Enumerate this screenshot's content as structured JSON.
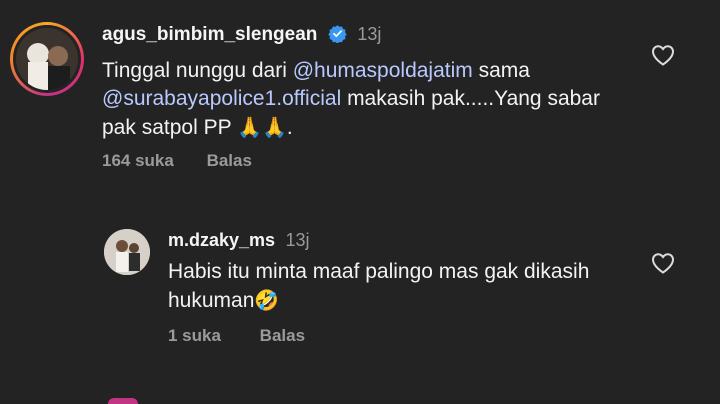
{
  "comments": [
    {
      "username": "agus_bimbim_slengean",
      "time": "13j",
      "text_before": "Tinggal nunggu dari ",
      "mention1": "@humaspoldajatim",
      "text_middle": " sama ",
      "mention2": "@surabayapolice1.official",
      "text_after": " makasih pak.....Yang sabar pak satpol PP ",
      "emoji": "🙏🙏",
      "text_end": ".",
      "likes": "164 suka",
      "reply_label": "Balas"
    },
    {
      "username": "m.dzaky_ms",
      "time": "13j",
      "text": "Habis itu minta maaf palingo mas gak dikasih hukuman",
      "emoji": "🤣",
      "likes": "1 suka",
      "reply_label": "Balas"
    }
  ],
  "colors": {
    "background": "#232323",
    "mention": "#b9c9ff",
    "verified": "#3897f0",
    "muted": "#9a9a9a"
  },
  "icons": [
    "verified-badge-icon",
    "heart-icon"
  ]
}
